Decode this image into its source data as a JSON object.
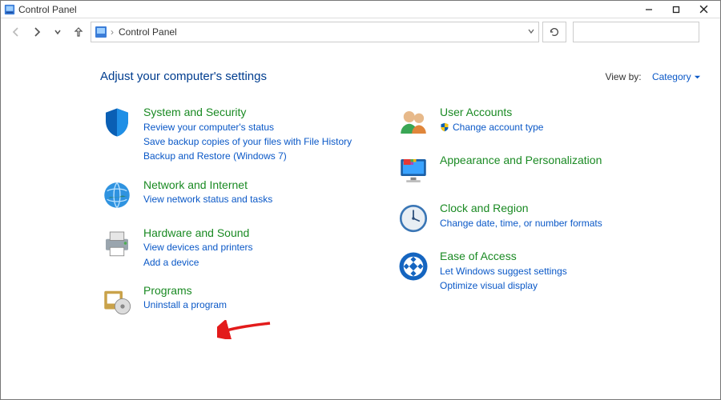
{
  "window_title": "Control Panel",
  "breadcrumb": {
    "root": "Control Panel"
  },
  "heading": "Adjust your computer's settings",
  "viewby": {
    "label": "View by:",
    "value": "Category"
  },
  "left": [
    {
      "title": "System and Security",
      "links": [
        "Review your computer's status",
        "Save backup copies of your files with File History",
        "Backup and Restore (Windows 7)"
      ]
    },
    {
      "title": "Network and Internet",
      "links": [
        "View network status and tasks"
      ]
    },
    {
      "title": "Hardware and Sound",
      "links": [
        "View devices and printers",
        "Add a device"
      ]
    },
    {
      "title": "Programs",
      "links": [
        "Uninstall a program"
      ]
    }
  ],
  "right": [
    {
      "title": "User Accounts",
      "links": [
        "Change account type"
      ],
      "shield_on_link": true
    },
    {
      "title": "Appearance and Personalization",
      "links": []
    },
    {
      "title": "Clock and Region",
      "links": [
        "Change date, time, or number formats"
      ]
    },
    {
      "title": "Ease of Access",
      "links": [
        "Let Windows suggest settings",
        "Optimize visual display"
      ]
    }
  ]
}
